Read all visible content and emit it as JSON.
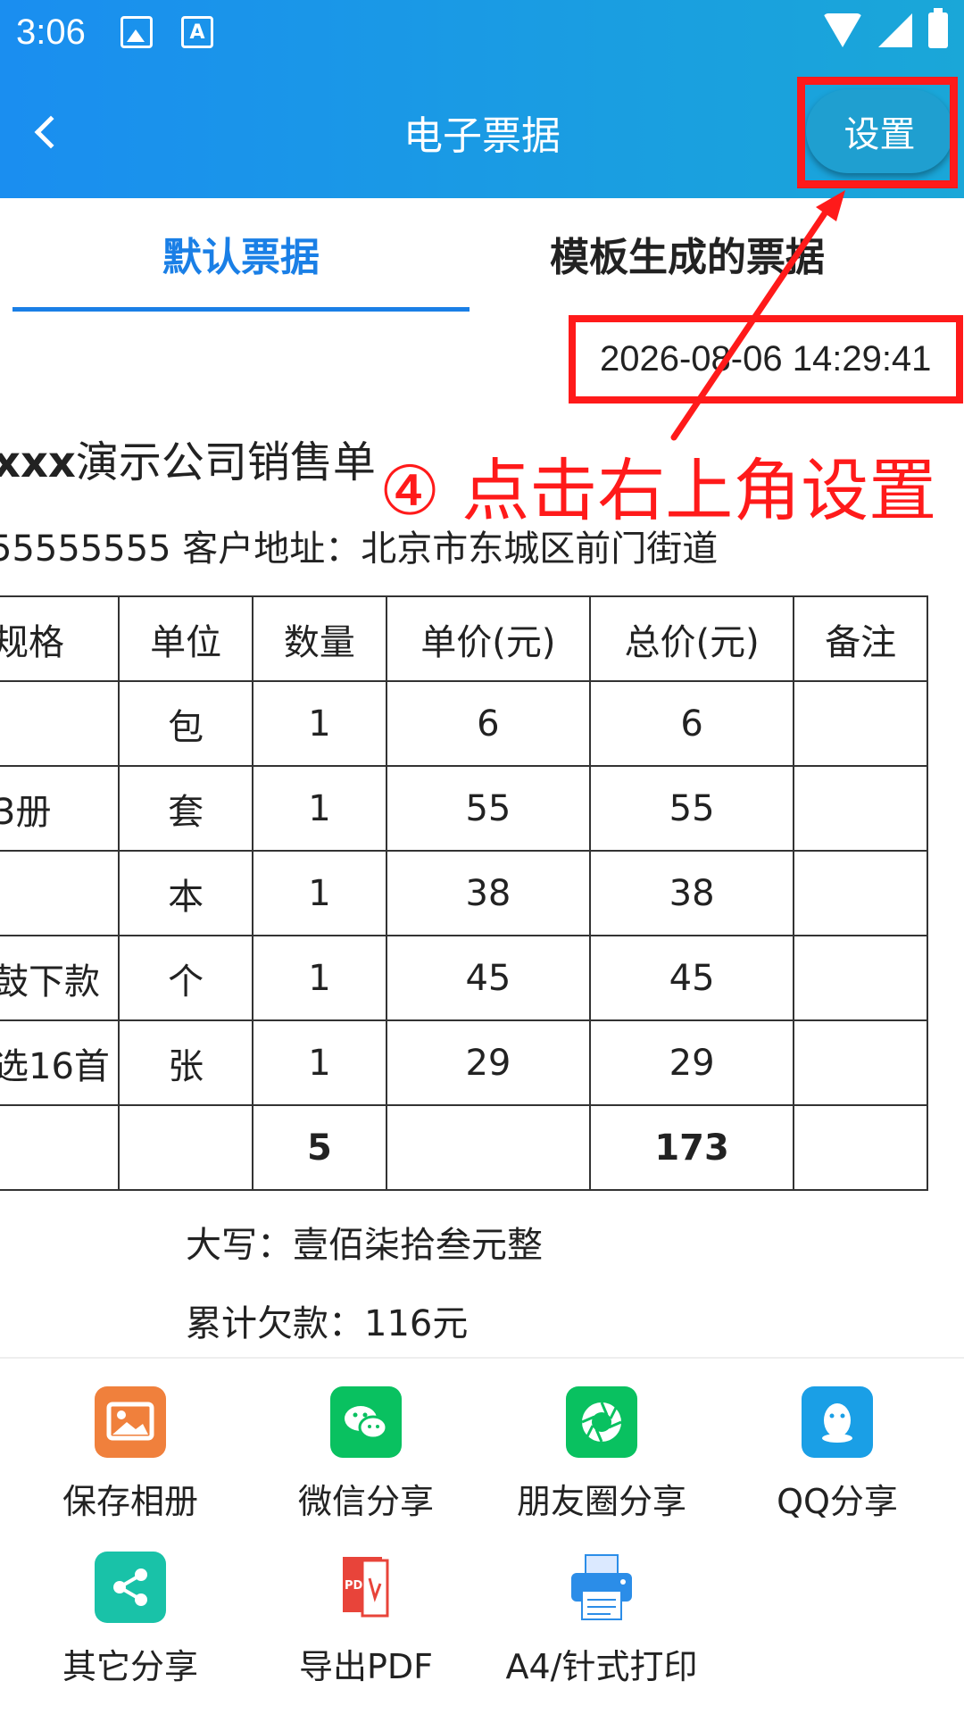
{
  "status_bar": {
    "time": "3:06",
    "notif_a": "A"
  },
  "header": {
    "title": "电子票据",
    "settings_label": "设置"
  },
  "tabs": [
    {
      "label": "默认票据"
    },
    {
      "label": "模板生成的票据"
    }
  ],
  "receipt": {
    "date": "2026-08-06 14:29:41",
    "company_prefix": "xxx",
    "company_rest": "演示公司销售单",
    "customer_line": "55555555    客户地址：北京市东城区前门街道",
    "table": {
      "headers": [
        "规格",
        "单位",
        "数量",
        "单价(元)",
        "总价(元)",
        "备注"
      ],
      "rows": [
        [
          "",
          "包",
          "1",
          "6",
          "6",
          ""
        ],
        [
          "3册",
          "套",
          "1",
          "55",
          "55",
          ""
        ],
        [
          "",
          "本",
          "1",
          "38",
          "38",
          ""
        ],
        [
          "鼓下款",
          "个",
          "1",
          "45",
          "45",
          ""
        ],
        [
          "选16首",
          "张",
          "1",
          "29",
          "29",
          ""
        ]
      ],
      "total": [
        "",
        "",
        "5",
        "",
        "173",
        ""
      ]
    },
    "amount_words": "大写：壹佰柒拾叁元整",
    "debt": "累计欠款：116元"
  },
  "annotation": {
    "text": "④ 点击右上角设置",
    "color": "#ff1a1a"
  },
  "actions": [
    {
      "label": "保存相册",
      "icon": "album-icon",
      "color": "#f0803c"
    },
    {
      "label": "微信分享",
      "icon": "wechat-icon",
      "color": "#09c160"
    },
    {
      "label": "朋友圈分享",
      "icon": "moments-icon",
      "color": "#09c160"
    },
    {
      "label": "QQ分享",
      "icon": "qq-icon",
      "color": "#1a9fe6"
    },
    {
      "label": "其它分享",
      "icon": "share-icon",
      "color": "#19c2a8"
    },
    {
      "label": "导出PDF",
      "icon": "pdf-icon",
      "color": "#e8443a"
    },
    {
      "label": "A4/针式打印",
      "icon": "printer-icon",
      "color": "#2b8de8"
    }
  ],
  "colors": {
    "header_start": "#1a8ef0",
    "header_end": "#1aa7d8",
    "accent": "#1a7fe6"
  }
}
